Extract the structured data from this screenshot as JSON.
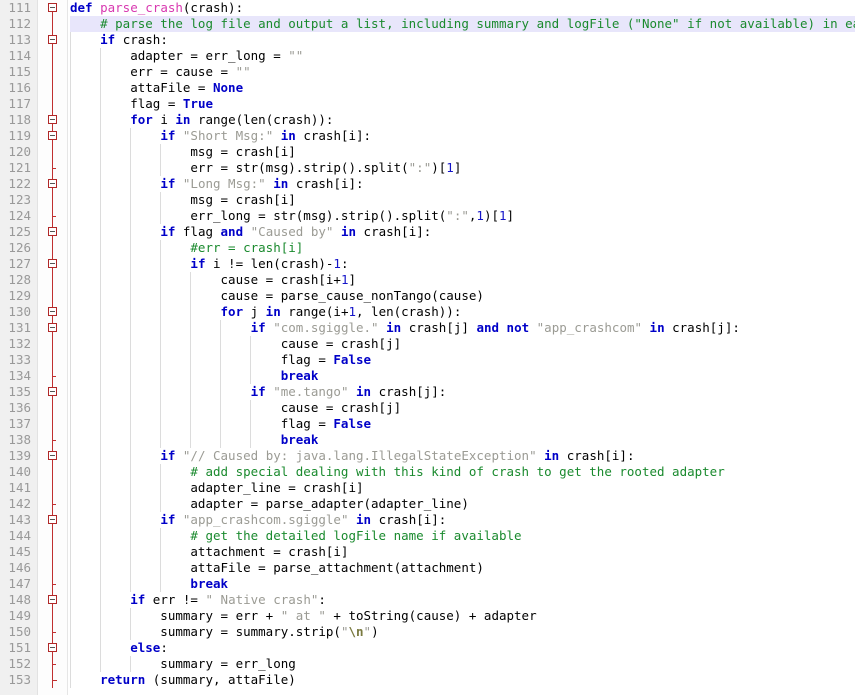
{
  "editor": {
    "language": "python",
    "first_line": 111,
    "last_line": 153,
    "current_line": 112,
    "colors": {
      "background": "#ffffff",
      "gutter_background": "#f0f0f0",
      "line_number": "#999999",
      "current_line_highlight": "#e8e6fb",
      "keyword": "#0000c8",
      "function_name": "#d838b0",
      "string": "#9b9b94",
      "comment": "#1a8a2e",
      "number": "#1414c8",
      "escape": "#7a7a40",
      "fold_marker": "#b02828",
      "indent_guide": "#dcdcdc"
    }
  },
  "lines": [
    {
      "num": "111",
      "indent": 0,
      "fold": "open",
      "tokens": [
        {
          "t": "def",
          "c": "kw"
        },
        {
          "t": " ",
          "c": "plain"
        },
        {
          "t": "parse_crash",
          "c": "fn"
        },
        {
          "t": "(crash):",
          "c": "plain"
        }
      ]
    },
    {
      "num": "112",
      "indent": 1,
      "fold": "line",
      "current": true,
      "tokens": [
        {
          "t": "    # parse the log file and output a list, including summary and logFile (\"None\" if not available) in each item",
          "c": "com"
        }
      ]
    },
    {
      "num": "113",
      "indent": 1,
      "fold": "open",
      "tokens": [
        {
          "t": "    ",
          "c": "plain"
        },
        {
          "t": "if",
          "c": "kw"
        },
        {
          "t": " crash:",
          "c": "plain"
        }
      ]
    },
    {
      "num": "114",
      "indent": 2,
      "fold": "line",
      "tokens": [
        {
          "t": "        adapter = err_long = ",
          "c": "plain"
        },
        {
          "t": "\"\"",
          "c": "str"
        }
      ]
    },
    {
      "num": "115",
      "indent": 2,
      "fold": "line",
      "tokens": [
        {
          "t": "        err = cause = ",
          "c": "plain"
        },
        {
          "t": "\"\"",
          "c": "str"
        }
      ]
    },
    {
      "num": "116",
      "indent": 2,
      "fold": "line",
      "tokens": [
        {
          "t": "        attaFile = ",
          "c": "plain"
        },
        {
          "t": "None",
          "c": "kw"
        }
      ]
    },
    {
      "num": "117",
      "indent": 2,
      "fold": "line",
      "tokens": [
        {
          "t": "        flag = ",
          "c": "plain"
        },
        {
          "t": "True",
          "c": "kw"
        }
      ]
    },
    {
      "num": "118",
      "indent": 2,
      "fold": "open",
      "tokens": [
        {
          "t": "        ",
          "c": "plain"
        },
        {
          "t": "for",
          "c": "kw"
        },
        {
          "t": " i ",
          "c": "plain"
        },
        {
          "t": "in",
          "c": "kw"
        },
        {
          "t": " range(len(crash)):",
          "c": "plain"
        }
      ]
    },
    {
      "num": "119",
      "indent": 3,
      "fold": "open",
      "tokens": [
        {
          "t": "            ",
          "c": "plain"
        },
        {
          "t": "if",
          "c": "kw"
        },
        {
          "t": " ",
          "c": "plain"
        },
        {
          "t": "\"Short Msg:\"",
          "c": "str"
        },
        {
          "t": " ",
          "c": "plain"
        },
        {
          "t": "in",
          "c": "kw"
        },
        {
          "t": " crash[i]:",
          "c": "plain"
        }
      ]
    },
    {
      "num": "120",
      "indent": 4,
      "fold": "line",
      "tokens": [
        {
          "t": "                msg = crash[i]",
          "c": "plain"
        }
      ]
    },
    {
      "num": "121",
      "indent": 4,
      "fold": "tick",
      "tokens": [
        {
          "t": "                err = str(msg).strip().split(",
          "c": "plain"
        },
        {
          "t": "\":\"",
          "c": "str"
        },
        {
          "t": ")[",
          "c": "plain"
        },
        {
          "t": "1",
          "c": "num"
        },
        {
          "t": "]",
          "c": "plain"
        }
      ]
    },
    {
      "num": "122",
      "indent": 3,
      "fold": "open",
      "tokens": [
        {
          "t": "            ",
          "c": "plain"
        },
        {
          "t": "if",
          "c": "kw"
        },
        {
          "t": " ",
          "c": "plain"
        },
        {
          "t": "\"Long Msg:\"",
          "c": "str"
        },
        {
          "t": " ",
          "c": "plain"
        },
        {
          "t": "in",
          "c": "kw"
        },
        {
          "t": " crash[i]:",
          "c": "plain"
        }
      ]
    },
    {
      "num": "123",
      "indent": 4,
      "fold": "line",
      "tokens": [
        {
          "t": "                msg = crash[i]",
          "c": "plain"
        }
      ]
    },
    {
      "num": "124",
      "indent": 4,
      "fold": "tick",
      "tokens": [
        {
          "t": "                err_long = str(msg).strip().split(",
          "c": "plain"
        },
        {
          "t": "\":\"",
          "c": "str"
        },
        {
          "t": ",",
          "c": "plain"
        },
        {
          "t": "1",
          "c": "num"
        },
        {
          "t": ")[",
          "c": "plain"
        },
        {
          "t": "1",
          "c": "num"
        },
        {
          "t": "]",
          "c": "plain"
        }
      ]
    },
    {
      "num": "125",
      "indent": 3,
      "fold": "open",
      "tokens": [
        {
          "t": "            ",
          "c": "plain"
        },
        {
          "t": "if",
          "c": "kw"
        },
        {
          "t": " flag ",
          "c": "plain"
        },
        {
          "t": "and",
          "c": "kw"
        },
        {
          "t": " ",
          "c": "plain"
        },
        {
          "t": "\"Caused by\"",
          "c": "str"
        },
        {
          "t": " ",
          "c": "plain"
        },
        {
          "t": "in",
          "c": "kw"
        },
        {
          "t": " crash[i]:",
          "c": "plain"
        }
      ]
    },
    {
      "num": "126",
      "indent": 4,
      "fold": "line",
      "tokens": [
        {
          "t": "                #err = crash[i]",
          "c": "com"
        }
      ]
    },
    {
      "num": "127",
      "indent": 4,
      "fold": "open",
      "tokens": [
        {
          "t": "                ",
          "c": "plain"
        },
        {
          "t": "if",
          "c": "kw"
        },
        {
          "t": " i != len(crash)-",
          "c": "plain"
        },
        {
          "t": "1",
          "c": "num"
        },
        {
          "t": ":",
          "c": "plain"
        }
      ]
    },
    {
      "num": "128",
      "indent": 5,
      "fold": "line",
      "tokens": [
        {
          "t": "                    cause = crash[i+",
          "c": "plain"
        },
        {
          "t": "1",
          "c": "num"
        },
        {
          "t": "]",
          "c": "plain"
        }
      ]
    },
    {
      "num": "129",
      "indent": 5,
      "fold": "line",
      "tokens": [
        {
          "t": "                    cause = parse_cause_nonTango(cause)",
          "c": "plain"
        }
      ]
    },
    {
      "num": "130",
      "indent": 5,
      "fold": "open",
      "tokens": [
        {
          "t": "                    ",
          "c": "plain"
        },
        {
          "t": "for",
          "c": "kw"
        },
        {
          "t": " j ",
          "c": "plain"
        },
        {
          "t": "in",
          "c": "kw"
        },
        {
          "t": " range(i+",
          "c": "plain"
        },
        {
          "t": "1",
          "c": "num"
        },
        {
          "t": ", len(crash)):",
          "c": "plain"
        }
      ]
    },
    {
      "num": "131",
      "indent": 6,
      "fold": "open",
      "tokens": [
        {
          "t": "                        ",
          "c": "plain"
        },
        {
          "t": "if",
          "c": "kw"
        },
        {
          "t": " ",
          "c": "plain"
        },
        {
          "t": "\"com.sgiggle.\"",
          "c": "str"
        },
        {
          "t": " ",
          "c": "plain"
        },
        {
          "t": "in",
          "c": "kw"
        },
        {
          "t": " crash[j] ",
          "c": "plain"
        },
        {
          "t": "and",
          "c": "kw"
        },
        {
          "t": " ",
          "c": "plain"
        },
        {
          "t": "not",
          "c": "kw"
        },
        {
          "t": " ",
          "c": "plain"
        },
        {
          "t": "\"app_crashcom\"",
          "c": "str"
        },
        {
          "t": " ",
          "c": "plain"
        },
        {
          "t": "in",
          "c": "kw"
        },
        {
          "t": " crash[j]:",
          "c": "plain"
        }
      ]
    },
    {
      "num": "132",
      "indent": 7,
      "fold": "line",
      "tokens": [
        {
          "t": "                            cause = crash[j]",
          "c": "plain"
        }
      ]
    },
    {
      "num": "133",
      "indent": 7,
      "fold": "line",
      "tokens": [
        {
          "t": "                            flag = ",
          "c": "plain"
        },
        {
          "t": "False",
          "c": "kw"
        }
      ]
    },
    {
      "num": "134",
      "indent": 7,
      "fold": "tick",
      "tokens": [
        {
          "t": "                            ",
          "c": "plain"
        },
        {
          "t": "break",
          "c": "kw"
        }
      ]
    },
    {
      "num": "135",
      "indent": 6,
      "fold": "open",
      "tokens": [
        {
          "t": "                        ",
          "c": "plain"
        },
        {
          "t": "if",
          "c": "kw"
        },
        {
          "t": " ",
          "c": "plain"
        },
        {
          "t": "\"me.tango\"",
          "c": "str"
        },
        {
          "t": " ",
          "c": "plain"
        },
        {
          "t": "in",
          "c": "kw"
        },
        {
          "t": " crash[j]:",
          "c": "plain"
        }
      ]
    },
    {
      "num": "136",
      "indent": 7,
      "fold": "line",
      "tokens": [
        {
          "t": "                            cause = crash[j]",
          "c": "plain"
        }
      ]
    },
    {
      "num": "137",
      "indent": 7,
      "fold": "line",
      "tokens": [
        {
          "t": "                            flag = ",
          "c": "plain"
        },
        {
          "t": "False",
          "c": "kw"
        }
      ]
    },
    {
      "num": "138",
      "indent": 7,
      "fold": "tick",
      "tokens": [
        {
          "t": "                            ",
          "c": "plain"
        },
        {
          "t": "break",
          "c": "kw"
        }
      ]
    },
    {
      "num": "139",
      "indent": 3,
      "fold": "open",
      "tokens": [
        {
          "t": "            ",
          "c": "plain"
        },
        {
          "t": "if",
          "c": "kw"
        },
        {
          "t": " ",
          "c": "plain"
        },
        {
          "t": "\"// Caused by: java.lang.IllegalStateException\"",
          "c": "str"
        },
        {
          "t": " ",
          "c": "plain"
        },
        {
          "t": "in",
          "c": "kw"
        },
        {
          "t": " crash[i]:",
          "c": "plain"
        }
      ]
    },
    {
      "num": "140",
      "indent": 4,
      "fold": "line",
      "tokens": [
        {
          "t": "                # add special dealing with this kind of crash to get the rooted adapter",
          "c": "com"
        }
      ]
    },
    {
      "num": "141",
      "indent": 4,
      "fold": "line",
      "tokens": [
        {
          "t": "                adapter_line = crash[i]",
          "c": "plain"
        }
      ]
    },
    {
      "num": "142",
      "indent": 4,
      "fold": "tick",
      "tokens": [
        {
          "t": "                adapter = parse_adapter(adapter_line)",
          "c": "plain"
        }
      ]
    },
    {
      "num": "143",
      "indent": 3,
      "fold": "open",
      "tokens": [
        {
          "t": "            ",
          "c": "plain"
        },
        {
          "t": "if",
          "c": "kw"
        },
        {
          "t": " ",
          "c": "plain"
        },
        {
          "t": "\"app_crashcom.sgiggle\"",
          "c": "str"
        },
        {
          "t": " ",
          "c": "plain"
        },
        {
          "t": "in",
          "c": "kw"
        },
        {
          "t": " crash[i]:",
          "c": "plain"
        }
      ]
    },
    {
      "num": "144",
      "indent": 4,
      "fold": "line",
      "tokens": [
        {
          "t": "                # get the detailed logFile name if available",
          "c": "com"
        }
      ]
    },
    {
      "num": "145",
      "indent": 4,
      "fold": "line",
      "tokens": [
        {
          "t": "                attachment = crash[i]",
          "c": "plain"
        }
      ]
    },
    {
      "num": "146",
      "indent": 4,
      "fold": "line",
      "tokens": [
        {
          "t": "                attaFile = parse_attachment(attachment)",
          "c": "plain"
        }
      ]
    },
    {
      "num": "147",
      "indent": 4,
      "fold": "tick",
      "tokens": [
        {
          "t": "                ",
          "c": "plain"
        },
        {
          "t": "break",
          "c": "kw"
        }
      ]
    },
    {
      "num": "148",
      "indent": 2,
      "fold": "open",
      "tokens": [
        {
          "t": "        ",
          "c": "plain"
        },
        {
          "t": "if",
          "c": "kw"
        },
        {
          "t": " err != ",
          "c": "plain"
        },
        {
          "t": "\" Native crash\"",
          "c": "str"
        },
        {
          "t": ":",
          "c": "plain"
        }
      ]
    },
    {
      "num": "149",
      "indent": 3,
      "fold": "line",
      "tokens": [
        {
          "t": "            summary = err + ",
          "c": "plain"
        },
        {
          "t": "\" at \"",
          "c": "str"
        },
        {
          "t": " + toString(cause) + adapter",
          "c": "plain"
        }
      ]
    },
    {
      "num": "150",
      "indent": 3,
      "fold": "tick",
      "tokens": [
        {
          "t": "            summary = summary.strip(",
          "c": "plain"
        },
        {
          "t": "\"",
          "c": "str"
        },
        {
          "t": "\\n",
          "c": "esc"
        },
        {
          "t": "\"",
          "c": "str"
        },
        {
          "t": ")",
          "c": "plain"
        }
      ]
    },
    {
      "num": "151",
      "indent": 2,
      "fold": "open",
      "tokens": [
        {
          "t": "        ",
          "c": "plain"
        },
        {
          "t": "else",
          "c": "kw"
        },
        {
          "t": ":",
          "c": "plain"
        }
      ]
    },
    {
      "num": "152",
      "indent": 3,
      "fold": "tick",
      "tokens": [
        {
          "t": "            summary = err_long",
          "c": "plain"
        }
      ]
    },
    {
      "num": "153",
      "indent": 1,
      "fold": "end",
      "tokens": [
        {
          "t": "    ",
          "c": "plain"
        },
        {
          "t": "return",
          "c": "kw"
        },
        {
          "t": " (summary, attaFile)",
          "c": "plain"
        }
      ]
    }
  ]
}
